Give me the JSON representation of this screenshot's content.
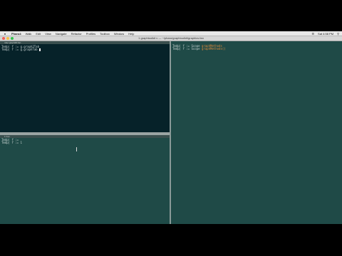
{
  "menubar": {
    "app": "Pharo",
    "items": [
      "Pharo4",
      "Walk",
      "Edit",
      "View",
      "Navigate",
      "Refactor",
      "Profiles",
      "Toolbox",
      "Window",
      "Help"
    ],
    "clock": "Sat 4:58 PM"
  },
  "window": {
    "title": "1 graphtoolkit v — ~/pharo/graphtoolkit/graphics.fan"
  },
  "panes": {
    "top_left": {
      "tab": "rdep:graph2D.fan",
      "lines": [
        "Tmdp| f := g.graph2Tab",
        "Tmdp| f := g.graphTab"
      ]
    },
    "bottom_left": {
      "tab": "1 Fan",
      "lines": [
        "Tmdp| f :=",
        "Tmdp| f := 1"
      ]
    },
    "right": {
      "lines_a": [
        "Tmdp| f := Scope ",
        "Tmdp| f := Scope "
      ],
      "lines_b": [
        "graphMethods",
        "graphMethods()"
      ]
    }
  },
  "colors": {
    "terminal_dark": "#062229",
    "terminal_teal": "#1f4a47",
    "menubar": "#e8e8e8",
    "string": "#e38b3a"
  }
}
